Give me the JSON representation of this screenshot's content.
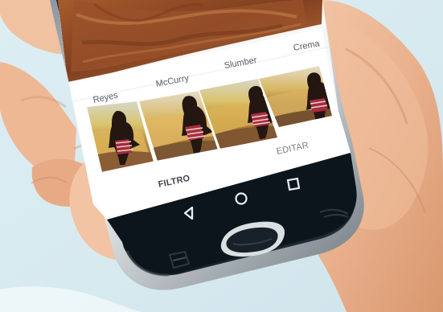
{
  "filters": [
    {
      "label": "Reyes"
    },
    {
      "label": "McCurry"
    },
    {
      "label": "Slumber"
    },
    {
      "label": "Crema"
    }
  ],
  "mode_tabs": {
    "filter_label": "FILTRO",
    "edit_label": "EDITAR"
  },
  "navigation_icons": {
    "back": "back-triangle-icon",
    "home": "home-circle-icon",
    "overview": "square-overview-icon"
  }
}
